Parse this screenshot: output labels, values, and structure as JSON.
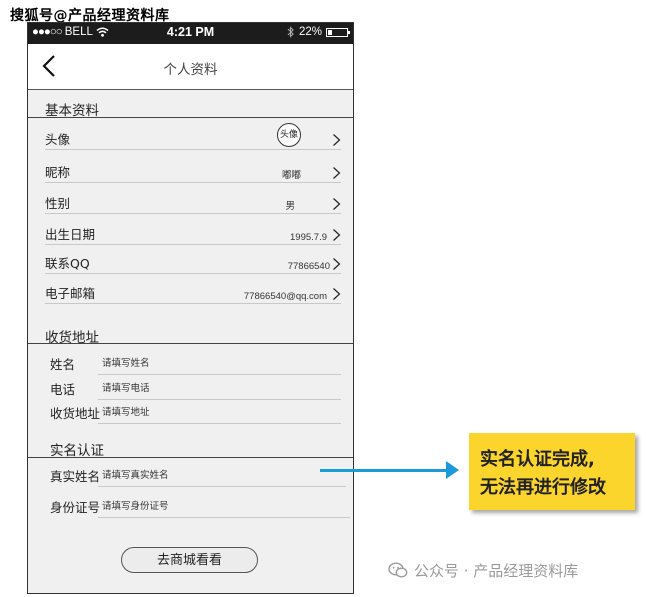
{
  "watermark_top": "搜狐号@产品经理资料库",
  "status_bar": {
    "signal_dots": "●●●○○",
    "carrier": "BELL",
    "time": "4:21 PM",
    "battery_percent": "22%",
    "battery_level": 0.22
  },
  "nav": {
    "title": "个人资料",
    "back_icon": "chevron-left-icon"
  },
  "basic": {
    "title": "基本资料",
    "rows": [
      {
        "label": "头像",
        "value": "头像"
      },
      {
        "label": "昵称",
        "value": "嘟嘟"
      },
      {
        "label": "性别",
        "value": "男"
      },
      {
        "label": "出生日期",
        "value": "1995.7.9"
      },
      {
        "label": "联系QQ",
        "value": "77866540"
      },
      {
        "label": "电子邮箱",
        "value": "77866540@qq.com"
      }
    ]
  },
  "address": {
    "title": "收货地址",
    "fields": [
      {
        "label": "姓名",
        "placeholder": "请填写姓名"
      },
      {
        "label": "电话",
        "placeholder": "请填写电话"
      },
      {
        "label": "收货地址",
        "placeholder": "请填写地址"
      }
    ]
  },
  "verify": {
    "title": "实名认证",
    "fields": [
      {
        "label": "真实姓名",
        "placeholder": "请填写真实姓名"
      },
      {
        "label": "身份证号",
        "placeholder": "请填写身份证号"
      }
    ]
  },
  "shop_button": "去商城看看",
  "annotation": {
    "line1": "实名认证完成,",
    "line2": "无法再进行修改"
  },
  "watermark_bottom": "公众号 · 产品经理资料库",
  "colors": {
    "arrow": "#1a9ad6",
    "note_bg": "#fcd52c",
    "statusbar_bg": "#1c1c1c"
  }
}
